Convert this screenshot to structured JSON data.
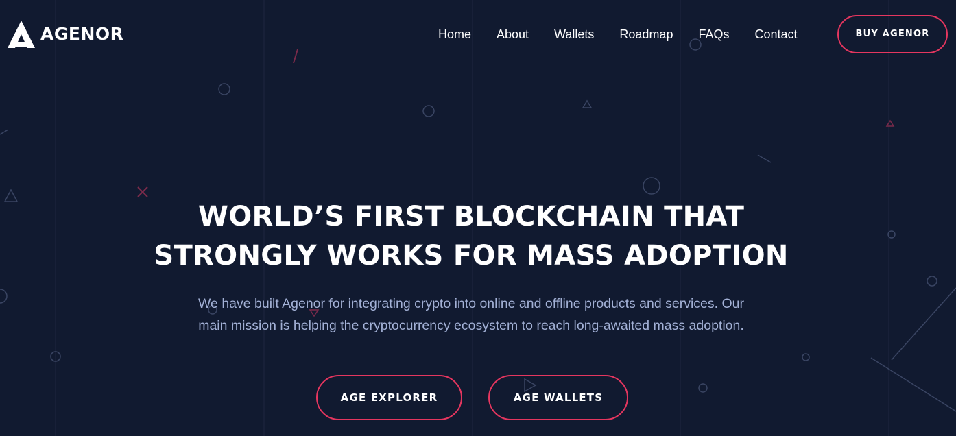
{
  "brand": {
    "name": "AGENOR",
    "logo_icon": "agenor-a-mark-icon"
  },
  "nav": {
    "items": [
      {
        "label": "Home"
      },
      {
        "label": "About"
      },
      {
        "label": "Wallets"
      },
      {
        "label": "Roadmap"
      },
      {
        "label": "FAQs"
      },
      {
        "label": "Contact"
      }
    ],
    "cta_label": "BUY AGENOR"
  },
  "hero": {
    "title_line1": "WORLD’S FIRST BLOCKCHAIN THAT",
    "title_line2": "STRONGLY WORKS FOR MASS ADOPTION",
    "subtitle_line1": "We have built Agenor for integrating crypto into online and offline products and services. Our",
    "subtitle_line2": "main mission is helping the cryptocurrency ecosystem to reach long-awaited mass adoption.",
    "buttons": {
      "explorer_label": "AGE EXPLORER",
      "wallets_label": "AGE WALLETS"
    }
  },
  "colors": {
    "background": "#111a30",
    "accent": "#e5365f",
    "text": "#ffffff",
    "subtitle_text": "#a3b1d6"
  }
}
